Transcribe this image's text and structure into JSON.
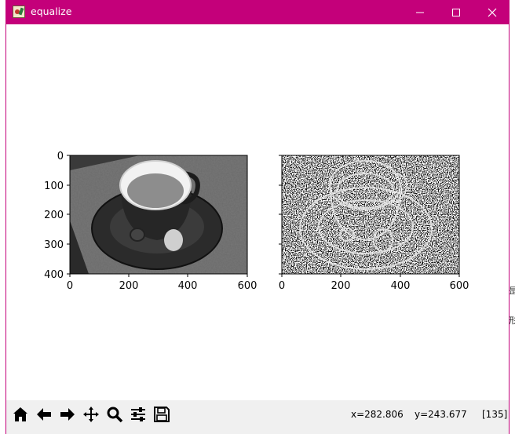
{
  "window": {
    "title": "equalize",
    "title_bar_color": "#c4007a"
  },
  "figure": {
    "left_plot": {
      "y_ticks": [
        "0",
        "100",
        "200",
        "300",
        "400"
      ],
      "x_ticks": [
        "0",
        "200",
        "400",
        "600"
      ],
      "image_description_icon": "espresso-cup-grayscale"
    },
    "right_plot": {
      "x_ticks": [
        "0",
        "200",
        "400",
        "600"
      ],
      "image_description_icon": "espresso-cup-edge-noise"
    }
  },
  "toolbar": {
    "buttons": [
      {
        "name": "home",
        "icon": "home-icon"
      },
      {
        "name": "back",
        "icon": "arrow-left-icon"
      },
      {
        "name": "forward",
        "icon": "arrow-right-icon"
      },
      {
        "name": "pan",
        "icon": "move-icon"
      },
      {
        "name": "zoom",
        "icon": "magnifier-icon"
      },
      {
        "name": "configure",
        "icon": "sliders-icon"
      },
      {
        "name": "save",
        "icon": "save-icon"
      }
    ],
    "status_x": "x=282.806",
    "status_y": "y=243.677",
    "pixel_value": "[135]"
  },
  "background_fragments": {
    "right_char_1": "昰",
    "right_char_2": "形"
  }
}
